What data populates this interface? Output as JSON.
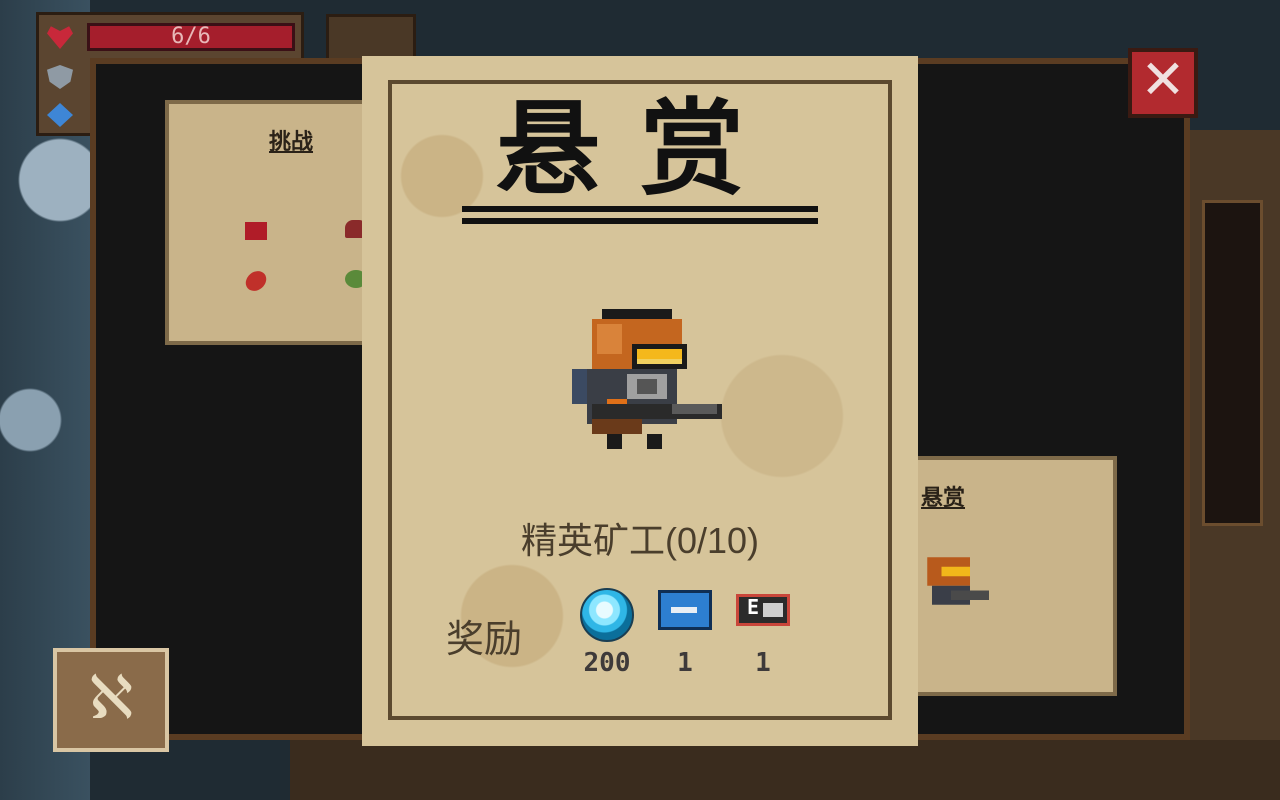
{
  "hud": {
    "hp_text": "6/6",
    "icons": [
      "heart-icon",
      "shield-icon",
      "energy-gem-icon"
    ]
  },
  "background_posters": {
    "left_title": "挑战",
    "right_title": "悬赏"
  },
  "bounty": {
    "title": "悬赏",
    "target_name": "精英矿工(0/10)",
    "reward_label": "奖励",
    "rewards": [
      {
        "icon": "gem-icon",
        "count": "200"
      },
      {
        "icon": "weapon-blueprint-icon",
        "count": "1"
      },
      {
        "icon": "card-icon",
        "count": "1"
      }
    ]
  },
  "buttons": {
    "close": "✕",
    "scroll": "ℵ"
  },
  "colors": {
    "parchment": "#d6c49a",
    "ink": "#111111",
    "close_red": "#b22a2f",
    "hp_red": "#a51e2c"
  }
}
